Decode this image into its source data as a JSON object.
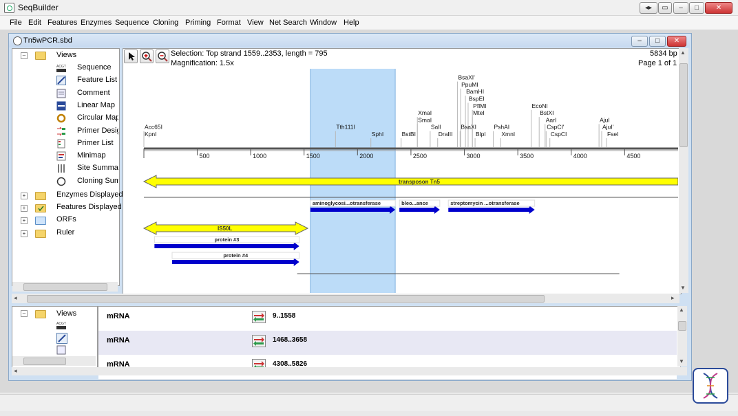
{
  "app": {
    "title": "SeqBuilder"
  },
  "menu": [
    "File",
    "Edit",
    "Features",
    "Enzymes",
    "Sequence",
    "Cloning",
    "Priming",
    "Format",
    "View",
    "Net Search",
    "Window",
    "Help"
  ],
  "document": {
    "title": "Tn5wPCR.sbd"
  },
  "tree": {
    "views_label": "Views",
    "items": [
      "Sequence",
      "Feature List",
      "Comment",
      "Linear Map",
      "Circular Map",
      "Primer Design",
      "Primer List",
      "Minimap",
      "Site Summary",
      "Cloning Summary"
    ],
    "icons": [
      "sequence-icon",
      "feature-list-icon",
      "comment-icon",
      "linear-map-icon",
      "circular-map-icon",
      "primer-design-icon",
      "primer-list-icon",
      "minimap-icon",
      "site-summary-icon",
      "cloning-summary-icon"
    ],
    "groups": [
      "Enzymes Displayed",
      "Features Displayed",
      "ORFs",
      "Ruler"
    ]
  },
  "map": {
    "selection_text": "Selection: Top strand  1559..2353, length = 795",
    "magnification_text": "Magnification: 1.5x",
    "length_text": "5834 bp",
    "page_text": "Page 1 of 1",
    "total_bp": 5834,
    "selection": [
      1559,
      2353
    ],
    "ruler_ticks": [
      "500",
      "1000",
      "1500",
      "2000",
      "2500",
      "3000",
      "3500",
      "4000",
      "4500"
    ],
    "enzymes": [
      {
        "label": "Acc65I",
        "pos": 0.0,
        "row": 1
      },
      {
        "label": "KpnI",
        "pos": 0.0,
        "row": 0
      },
      {
        "label": "Tth111I",
        "pos": 1794,
        "row": 1
      },
      {
        "label": "SphI",
        "pos": 2125,
        "row": 0
      },
      {
        "label": "BstBI",
        "pos": 2408,
        "row": 0
      },
      {
        "label": "XmaI",
        "pos": 2560,
        "row": 3
      },
      {
        "label": "SmaI",
        "pos": 2560,
        "row": 2
      },
      {
        "label": "SalI",
        "pos": 2680,
        "row": 1
      },
      {
        "label": "DraIII",
        "pos": 2750,
        "row": 0
      },
      {
        "label": "BsaXI'",
        "pos": 2935,
        "row": 8
      },
      {
        "label": "PpuMI",
        "pos": 2965,
        "row": 7
      },
      {
        "label": "BamHI",
        "pos": 3010,
        "row": 6
      },
      {
        "label": "BspEI",
        "pos": 3035,
        "row": 5
      },
      {
        "label": "PflMI",
        "pos": 3075,
        "row": 4
      },
      {
        "label": "MteI",
        "pos": 3075,
        "row": 3
      },
      {
        "label": "BsaXI",
        "pos": 2960,
        "row": 1
      },
      {
        "label": "BlpI",
        "pos": 3100,
        "row": 0
      },
      {
        "label": "PshAI",
        "pos": 3270,
        "row": 1
      },
      {
        "label": "XmnI",
        "pos": 3340,
        "row": 0
      },
      {
        "label": "EcoNI",
        "pos": 3625,
        "row": 4
      },
      {
        "label": "BstXI",
        "pos": 3700,
        "row": 3
      },
      {
        "label": "AarI",
        "pos": 3755,
        "row": 2
      },
      {
        "label": "CspCI'",
        "pos": 3765,
        "row": 1
      },
      {
        "label": "CspCI",
        "pos": 3800,
        "row": 0
      },
      {
        "label": "AjuI",
        "pos": 4260,
        "row": 2
      },
      {
        "label": "AjuI'",
        "pos": 4285,
        "row": 1
      },
      {
        "label": "FseI",
        "pos": 4330,
        "row": 0
      }
    ],
    "features": [
      {
        "label": "transposon Tn5",
        "type": "yellow-left",
        "start": 1,
        "end": 5834,
        "row": 0
      },
      {
        "label": "aminoglycosi...otransferase",
        "type": "blue-right",
        "start": 1559,
        "end": 2353,
        "row": 1
      },
      {
        "label": "bleo...ance",
        "type": "blue-right",
        "start": 2392,
        "end": 2770,
        "row": 1
      },
      {
        "label": "streptomycin ...otransferase",
        "type": "blue-right",
        "start": 2850,
        "end": 3658,
        "row": 1
      },
      {
        "label": "IS50L",
        "type": "yellow-both",
        "start": 1,
        "end": 1535,
        "row": 2
      },
      {
        "label": "protein #3",
        "type": "blue-right",
        "start": 100,
        "end": 1455,
        "row": 3
      },
      {
        "label": "protein #4",
        "type": "blue-right",
        "start": 265,
        "end": 1455,
        "row": 4
      }
    ]
  },
  "bottom": {
    "views_label": "Views",
    "rows": [
      {
        "type": "mRNA",
        "range": "9..1558"
      },
      {
        "type": "mRNA",
        "range": "1468..3658"
      },
      {
        "type": "mRNA",
        "range": "4308..5826"
      }
    ]
  },
  "colors": {
    "feature_yellow": "#ffff00",
    "feature_blue": "#0000cc",
    "selection": "#bcdcf8"
  }
}
